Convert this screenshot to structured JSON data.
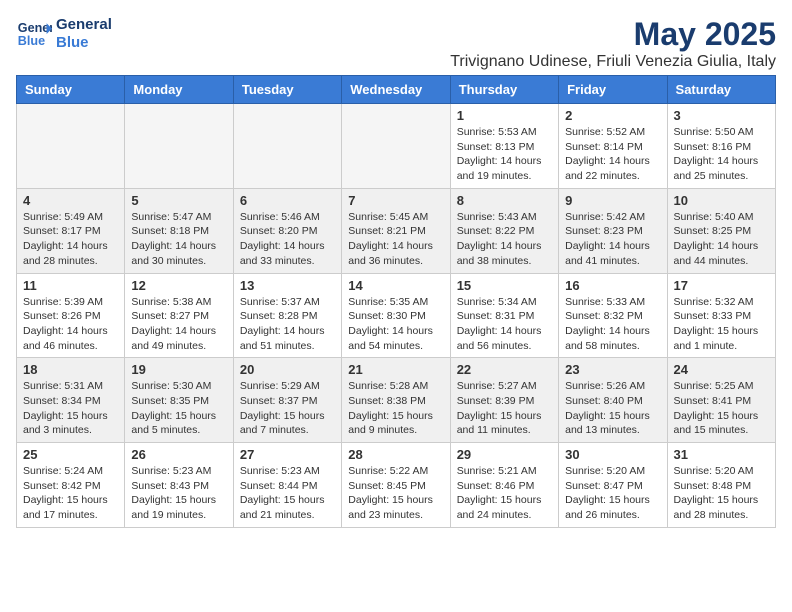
{
  "logo": {
    "text_general": "General",
    "text_blue": "Blue"
  },
  "header": {
    "month_year": "May 2025",
    "location": "Trivignano Udinese, Friuli Venezia Giulia, Italy"
  },
  "days_of_week": [
    "Sunday",
    "Monday",
    "Tuesday",
    "Wednesday",
    "Thursday",
    "Friday",
    "Saturday"
  ],
  "weeks": [
    [
      {
        "day": "",
        "info": "",
        "empty": true
      },
      {
        "day": "",
        "info": "",
        "empty": true
      },
      {
        "day": "",
        "info": "",
        "empty": true
      },
      {
        "day": "",
        "info": "",
        "empty": true
      },
      {
        "day": "1",
        "info": "Sunrise: 5:53 AM\nSunset: 8:13 PM\nDaylight: 14 hours and 19 minutes."
      },
      {
        "day": "2",
        "info": "Sunrise: 5:52 AM\nSunset: 8:14 PM\nDaylight: 14 hours and 22 minutes."
      },
      {
        "day": "3",
        "info": "Sunrise: 5:50 AM\nSunset: 8:16 PM\nDaylight: 14 hours and 25 minutes."
      }
    ],
    [
      {
        "day": "4",
        "info": "Sunrise: 5:49 AM\nSunset: 8:17 PM\nDaylight: 14 hours and 28 minutes."
      },
      {
        "day": "5",
        "info": "Sunrise: 5:47 AM\nSunset: 8:18 PM\nDaylight: 14 hours and 30 minutes."
      },
      {
        "day": "6",
        "info": "Sunrise: 5:46 AM\nSunset: 8:20 PM\nDaylight: 14 hours and 33 minutes."
      },
      {
        "day": "7",
        "info": "Sunrise: 5:45 AM\nSunset: 8:21 PM\nDaylight: 14 hours and 36 minutes."
      },
      {
        "day": "8",
        "info": "Sunrise: 5:43 AM\nSunset: 8:22 PM\nDaylight: 14 hours and 38 minutes."
      },
      {
        "day": "9",
        "info": "Sunrise: 5:42 AM\nSunset: 8:23 PM\nDaylight: 14 hours and 41 minutes."
      },
      {
        "day": "10",
        "info": "Sunrise: 5:40 AM\nSunset: 8:25 PM\nDaylight: 14 hours and 44 minutes."
      }
    ],
    [
      {
        "day": "11",
        "info": "Sunrise: 5:39 AM\nSunset: 8:26 PM\nDaylight: 14 hours and 46 minutes."
      },
      {
        "day": "12",
        "info": "Sunrise: 5:38 AM\nSunset: 8:27 PM\nDaylight: 14 hours and 49 minutes."
      },
      {
        "day": "13",
        "info": "Sunrise: 5:37 AM\nSunset: 8:28 PM\nDaylight: 14 hours and 51 minutes."
      },
      {
        "day": "14",
        "info": "Sunrise: 5:35 AM\nSunset: 8:30 PM\nDaylight: 14 hours and 54 minutes."
      },
      {
        "day": "15",
        "info": "Sunrise: 5:34 AM\nSunset: 8:31 PM\nDaylight: 14 hours and 56 minutes."
      },
      {
        "day": "16",
        "info": "Sunrise: 5:33 AM\nSunset: 8:32 PM\nDaylight: 14 hours and 58 minutes."
      },
      {
        "day": "17",
        "info": "Sunrise: 5:32 AM\nSunset: 8:33 PM\nDaylight: 15 hours and 1 minute."
      }
    ],
    [
      {
        "day": "18",
        "info": "Sunrise: 5:31 AM\nSunset: 8:34 PM\nDaylight: 15 hours and 3 minutes."
      },
      {
        "day": "19",
        "info": "Sunrise: 5:30 AM\nSunset: 8:35 PM\nDaylight: 15 hours and 5 minutes."
      },
      {
        "day": "20",
        "info": "Sunrise: 5:29 AM\nSunset: 8:37 PM\nDaylight: 15 hours and 7 minutes."
      },
      {
        "day": "21",
        "info": "Sunrise: 5:28 AM\nSunset: 8:38 PM\nDaylight: 15 hours and 9 minutes."
      },
      {
        "day": "22",
        "info": "Sunrise: 5:27 AM\nSunset: 8:39 PM\nDaylight: 15 hours and 11 minutes."
      },
      {
        "day": "23",
        "info": "Sunrise: 5:26 AM\nSunset: 8:40 PM\nDaylight: 15 hours and 13 minutes."
      },
      {
        "day": "24",
        "info": "Sunrise: 5:25 AM\nSunset: 8:41 PM\nDaylight: 15 hours and 15 minutes."
      }
    ],
    [
      {
        "day": "25",
        "info": "Sunrise: 5:24 AM\nSunset: 8:42 PM\nDaylight: 15 hours and 17 minutes."
      },
      {
        "day": "26",
        "info": "Sunrise: 5:23 AM\nSunset: 8:43 PM\nDaylight: 15 hours and 19 minutes."
      },
      {
        "day": "27",
        "info": "Sunrise: 5:23 AM\nSunset: 8:44 PM\nDaylight: 15 hours and 21 minutes."
      },
      {
        "day": "28",
        "info": "Sunrise: 5:22 AM\nSunset: 8:45 PM\nDaylight: 15 hours and 23 minutes."
      },
      {
        "day": "29",
        "info": "Sunrise: 5:21 AM\nSunset: 8:46 PM\nDaylight: 15 hours and 24 minutes."
      },
      {
        "day": "30",
        "info": "Sunrise: 5:20 AM\nSunset: 8:47 PM\nDaylight: 15 hours and 26 minutes."
      },
      {
        "day": "31",
        "info": "Sunrise: 5:20 AM\nSunset: 8:48 PM\nDaylight: 15 hours and 28 minutes."
      }
    ]
  ]
}
